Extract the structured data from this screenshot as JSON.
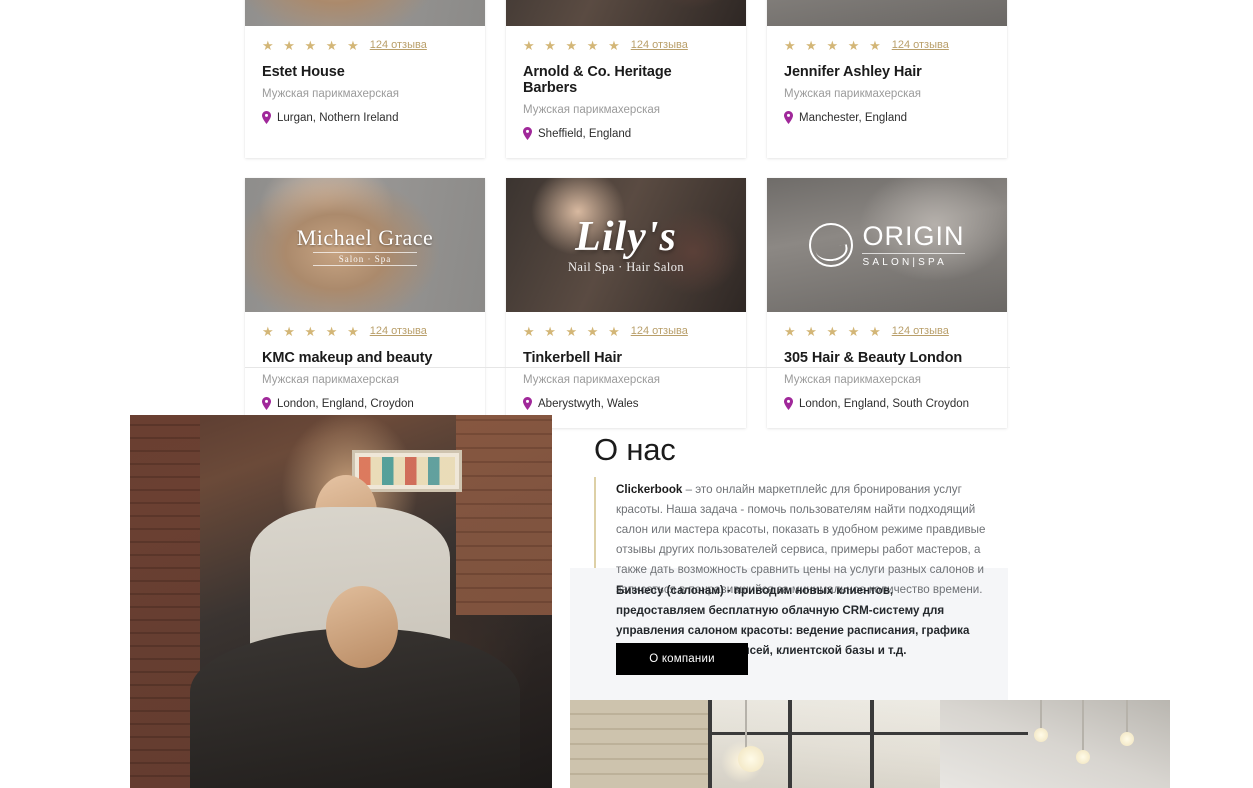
{
  "salons": [
    {
      "stars": "★ ★ ★ ★ ★",
      "reviews": "124 отзыва",
      "name": "Estet House",
      "type": "Мужская парикмахерская",
      "location": "Lurgan, Nothern Ireland",
      "photo": "none",
      "logo": "none"
    },
    {
      "stars": "★ ★ ★ ★ ★",
      "reviews": "124 отзыва",
      "name": "Arnold & Co. Heritage Barbers",
      "type": "Мужская парикмахерская",
      "location": "Sheffield, England",
      "photo": "none",
      "logo": "none"
    },
    {
      "stars": "★ ★ ★ ★ ★",
      "reviews": "124 отзыва",
      "name": "Jennifer Ashley Hair",
      "type": "Мужская парикмахерская",
      "location": "Manchester, England",
      "photo": "none",
      "logo": "none"
    },
    {
      "stars": "★ ★ ★ ★ ★",
      "reviews": "124 отзыва",
      "name": "KMC makeup and beauty",
      "type": "Мужская парикмахерская",
      "location": "London, England, Croydon",
      "photo": "salon-photo-woman-blonde-hair",
      "logo_name": "Michael Grace",
      "logo_sub": "Salon · Spa"
    },
    {
      "stars": "★ ★ ★ ★ ★",
      "reviews": "124 отзыва",
      "name": "Tinkerbell Hair",
      "type": "Мужская парикмахерская",
      "location": "Aberystwyth, Wales",
      "photo": "salon-photo-nail-technician",
      "logo_name": "Lily's",
      "logo_sub": "Nail Spa · Hair Salon"
    },
    {
      "stars": "★ ★ ★ ★ ★",
      "reviews": "124 отзыва",
      "name": "305 Hair & Beauty London",
      "type": "Мужская парикмахерская",
      "location": "London, England, South Croydon",
      "photo": "salon-photo-salon-interior",
      "logo_name": "ORIGIN",
      "logo_sub": "SALON|SPA"
    }
  ],
  "about": {
    "title": "О нас",
    "brand": "Clickerbook",
    "paragraph1": " – это онлайн маркетплейс для бронирования услуг красоты. Наша задача - помочь пользователям найти подходящий салон или мастера красоты, показать в удобном режиме правдивые отзывы других пользователей сервиса, примеры работ мастеров, а также дать возможность сравнить цены на услуги разных салонов и записаться в понравившийся за минимальное количество времени.",
    "paragraph2": "Бизнесу (салонам) - приводим новых клиентов, предоставляем бесплатную облачную CRM-систему для управления салоном красоты: ведение расписания, графика работы мастеров, записей, клиентской базы и т.д.",
    "button_label": "О компании"
  },
  "colors": {
    "star_gold": "#d3b677",
    "review_link": "#b99f6a",
    "pin_magenta": "#a0289a",
    "accent_bar": "#ddd0a6",
    "panel_bg": "#f5f6f8",
    "button_bg": "#000000"
  }
}
